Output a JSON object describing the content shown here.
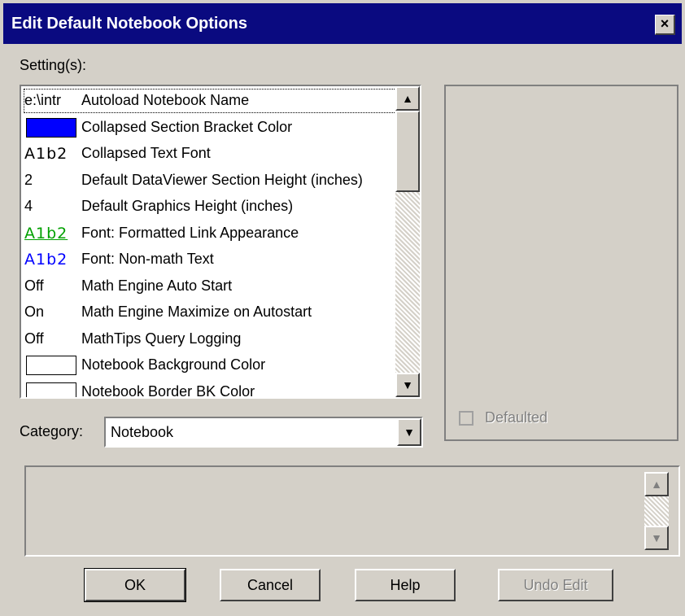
{
  "dialog": {
    "title": "Edit Default Notebook Options"
  },
  "labels": {
    "settings": "Setting(s):",
    "category": "Category:"
  },
  "settings": [
    {
      "value": "e:\\intr",
      "name": "Autoload Notebook Name",
      "kind": "text"
    },
    {
      "value": "",
      "name": "Collapsed Section Bracket Color",
      "kind": "color",
      "color": "#0000ff"
    },
    {
      "value": "A1b2",
      "name": "Collapsed Text Font",
      "kind": "font",
      "color": "#000000"
    },
    {
      "value": "2",
      "name": "Default DataViewer Section Height (inches)",
      "kind": "text"
    },
    {
      "value": "4",
      "name": "Default Graphics Height (inches)",
      "kind": "text"
    },
    {
      "value": "A1b2",
      "name": "Font: Formatted Link Appearance",
      "kind": "font",
      "color": "#00a000",
      "underline": true
    },
    {
      "value": "A1b2",
      "name": "Font: Non-math Text",
      "kind": "font",
      "color": "#0000ff"
    },
    {
      "value": "Off",
      "name": "Math Engine Auto Start",
      "kind": "text"
    },
    {
      "value": "On",
      "name": "Math Engine Maximize on Autostart",
      "kind": "text"
    },
    {
      "value": "Off",
      "name": "MathTips Query Logging",
      "kind": "text"
    },
    {
      "value": "",
      "name": "Notebook Background Color",
      "kind": "color",
      "color": "#ffffff"
    },
    {
      "value": "",
      "name": "Notebook Border BK Color",
      "kind": "color",
      "color": "#ffffff"
    }
  ],
  "category": {
    "value": "Notebook"
  },
  "defaulted": {
    "label": "Defaulted",
    "checked": false
  },
  "buttons": {
    "ok": "OK",
    "cancel": "Cancel",
    "help": "Help",
    "undo": "Undo Edit"
  },
  "icons": {
    "close": "×",
    "up": "▲",
    "down": "▼"
  }
}
